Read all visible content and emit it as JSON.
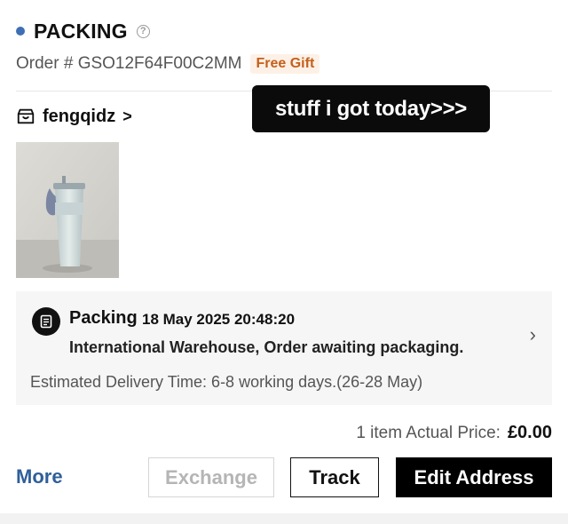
{
  "order": {
    "status_title": "PACKING",
    "order_number": "Order # GSO12F64F00C2MM",
    "badge": "Free Gift"
  },
  "store": {
    "name": "fengqidz",
    "chevron": ">",
    "icon": "store-icon"
  },
  "overlay": {
    "caption": "stuff i got today>>>"
  },
  "tracking": {
    "status": "Packing",
    "timestamp": "18 May 2025 20:48:20",
    "description": "International Warehouse, Order awaiting packaging.",
    "eta": "Estimated Delivery Time: 6-8 working days.(26-28 May)",
    "icon": "document-icon"
  },
  "summary": {
    "label": "1 item Actual Price:",
    "price": "£0.00"
  },
  "actions": {
    "more": "More",
    "exchange": "Exchange",
    "track": "Track",
    "edit_address": "Edit Address"
  },
  "colors": {
    "status_dot": "#3e6fb5",
    "badge_text": "#c55f1a",
    "more_link": "#2f5f9a"
  }
}
